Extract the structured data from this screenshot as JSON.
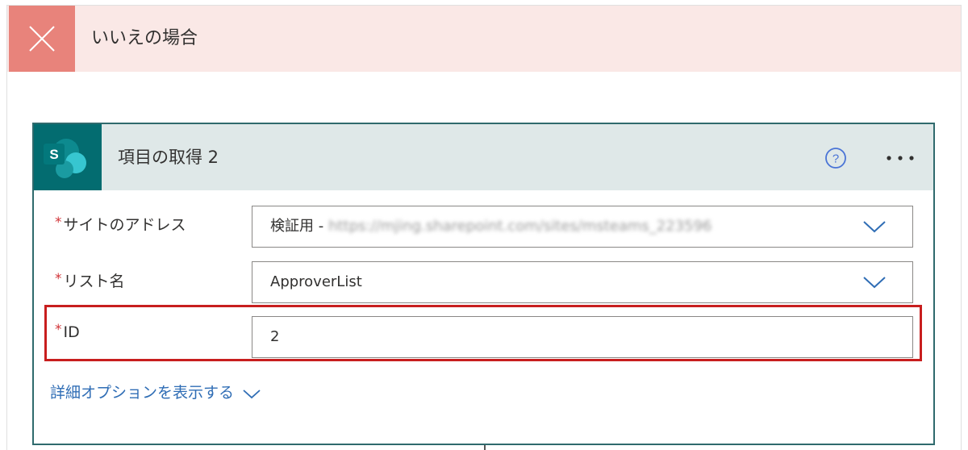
{
  "no_branch": {
    "title": "いいえの場合",
    "icon": "close-icon"
  },
  "action_card": {
    "title": "項目の取得 2",
    "icon": "sharepoint-icon",
    "icon_letter": "S",
    "help_icon": "help-icon",
    "more_icon": "more-options-icon",
    "fields": [
      {
        "required_mark": "*",
        "label": "サイトのアドレス",
        "value": "検証用 -",
        "value_blurred": "https://mjing.sharepoint.com/sites/msteams_223596",
        "dropdown": true
      },
      {
        "required_mark": "*",
        "label": "リスト名",
        "value": "ApproverList",
        "dropdown": true
      },
      {
        "required_mark": "*",
        "label": "ID",
        "value": "2",
        "dropdown": false
      }
    ],
    "advanced_options": "詳細オプションを表示する"
  },
  "colors": {
    "no_header_bg": "#fae8e6",
    "no_icon_bg": "#e8837b",
    "card_border": "#2f6a6d",
    "card_header_bg": "#dfe8e8",
    "sharepoint_teal": "#036c70",
    "link_blue": "#2f6db5",
    "required_red": "#d13438",
    "highlight_red": "#c81e1e"
  }
}
